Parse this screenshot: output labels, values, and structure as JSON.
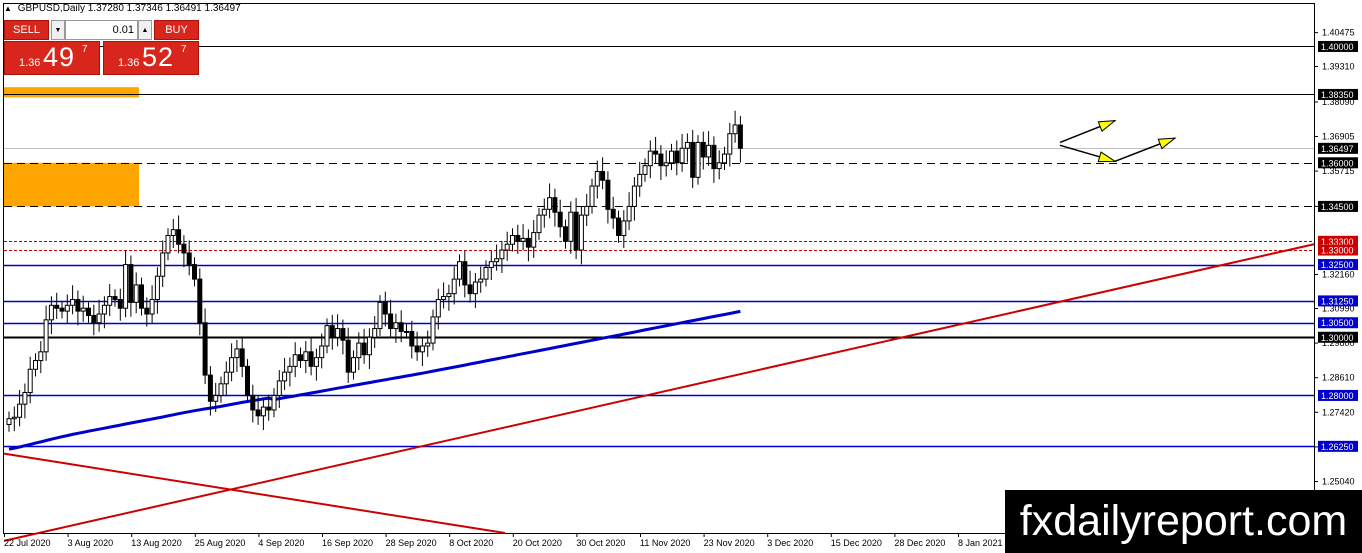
{
  "header": {
    "symbol_label": "GBPUSD,Daily",
    "ohlc": "1.37280 1.37346 1.36491 1.36497"
  },
  "trade_panel": {
    "sell_label": "SELL",
    "buy_label": "BUY",
    "lot_value": "0.01",
    "sell_price": {
      "prefix": "1.36",
      "big": "49",
      "sup": "7"
    },
    "buy_price": {
      "prefix": "1.36",
      "big": "52",
      "sup": "7"
    },
    "button_color": "#d9261c"
  },
  "watermark": "fxdailyreport.com",
  "chart_data": {
    "type": "candlestick",
    "symbol": "GBPUSD",
    "timeframe": "Daily",
    "ylim": [
      1.2327,
      1.4146
    ],
    "y_ticks": [
      "1.40475",
      "1.39310",
      "1.38090",
      "1.36905",
      "1.35715",
      "1.34500",
      "1.32160",
      "1.30990",
      "1.29800",
      "1.28610",
      "1.27420",
      "1.26230",
      "1.25040"
    ],
    "x_ticks": [
      "22 Jul 2020",
      "3 Aug 2020",
      "13 Aug 2020",
      "25 Aug 2020",
      "4 Sep 2020",
      "16 Sep 2020",
      "28 Sep 2020",
      "8 Oct 2020",
      "20 Oct 2020",
      "30 Oct 2020",
      "11 Nov 2020",
      "23 Nov 2020",
      "3 Dec 2020",
      "15 Dec 2020",
      "28 Dec 2020",
      "8 Jan 2021"
    ],
    "bullish_color": "#ffffff",
    "bearish_color": "#000000",
    "closes": [
      1.272,
      1.2725,
      1.277,
      1.281,
      1.289,
      1.292,
      1.295,
      1.306,
      1.311,
      1.31,
      1.309,
      1.311,
      1.313,
      1.309,
      1.31,
      1.3075,
      1.305,
      1.308,
      1.311,
      1.314,
      1.313,
      1.31,
      1.325,
      1.312,
      1.318,
      1.31,
      1.308,
      1.313,
      1.321,
      1.329,
      1.335,
      1.337,
      1.332,
      1.329,
      1.325,
      1.32,
      1.305,
      1.287,
      1.278,
      1.28,
      1.284,
      1.288,
      1.293,
      1.296,
      1.29,
      1.28,
      1.275,
      1.273,
      1.276,
      1.275,
      1.28,
      1.285,
      1.288,
      1.29,
      1.294,
      1.292,
      1.295,
      1.29,
      1.293,
      1.297,
      1.304,
      1.3,
      1.303,
      1.299,
      1.288,
      1.293,
      1.298,
      1.294,
      1.3,
      1.303,
      1.312,
      1.308,
      1.303,
      1.305,
      1.302,
      1.302,
      1.297,
      1.295,
      1.297,
      1.298,
      1.307,
      1.313,
      1.314,
      1.315,
      1.32,
      1.326,
      1.318,
      1.315,
      1.319,
      1.32,
      1.324,
      1.326,
      1.327,
      1.33,
      1.332,
      1.335,
      1.333,
      1.334,
      1.331,
      1.336,
      1.342,
      1.344,
      1.348,
      1.343,
      1.338,
      1.333,
      1.343,
      1.33,
      1.342,
      1.345,
      1.352,
      1.357,
      1.354,
      1.344,
      1.341,
      1.335,
      1.34,
      1.345,
      1.352,
      1.356,
      1.359,
      1.364,
      1.363,
      1.359,
      1.36,
      1.364,
      1.36,
      1.365,
      1.367,
      1.355,
      1.367,
      1.362,
      1.366,
      1.358,
      1.36,
      1.363,
      1.37,
      1.373,
      1.365
    ]
  },
  "levels": [
    {
      "label": "1.40000",
      "price": 1.4,
      "color": "#000000",
      "style": "solid",
      "label_bg": "#000000",
      "label_color": "#ffffff"
    },
    {
      "label": "1.38350",
      "price": 1.3835,
      "color": "#000000",
      "style": "solid",
      "label_bg": "#000000",
      "label_color": "#ffffff"
    },
    {
      "label": "1.36497",
      "price": 1.36497,
      "color": "#c0c0c0",
      "style": "solid",
      "label_bg": "#000000",
      "label_color": "#ffffff"
    },
    {
      "label": "1.36000",
      "price": 1.36,
      "color": "#000000",
      "style": "dashed",
      "label_bg": "#000000",
      "label_color": "#ffffff"
    },
    {
      "label": "1.34500",
      "price": 1.345,
      "color": "#000000",
      "style": "dashed",
      "label_bg": "#000000",
      "label_color": "#ffffff"
    },
    {
      "label": "1.33300",
      "price": 1.333,
      "color": "#cc0000",
      "style": "dotted",
      "label_bg": "#cc0000",
      "label_color": "#ffffff"
    },
    {
      "label": "1.33000",
      "price": 1.33,
      "color": "#cc0000",
      "style": "dotted",
      "label_bg": "#cc0000",
      "label_color": "#ffffff"
    },
    {
      "label": "1.32500",
      "price": 1.325,
      "color": "#0000cc",
      "style": "solid",
      "label_bg": "#0000cc",
      "label_color": "#ffffff"
    },
    {
      "label": "1.31250",
      "price": 1.3125,
      "color": "#0000cc",
      "style": "solid",
      "label_bg": "#0000cc",
      "label_color": "#ffffff"
    },
    {
      "label": "1.30500",
      "price": 1.305,
      "color": "#0000cc",
      "style": "solid",
      "label_bg": "#0000cc",
      "label_color": "#ffffff"
    },
    {
      "label": "1.30000",
      "price": 1.3,
      "color": "#000000",
      "style": "thick",
      "label_bg": "#000000",
      "label_color": "#ffffff"
    },
    {
      "label": "1.28000",
      "price": 1.28,
      "color": "#0000cc",
      "style": "solid",
      "label_bg": "#0000cc",
      "label_color": "#ffffff"
    },
    {
      "label": "1.26250",
      "price": 1.2625,
      "color": "#0000cc",
      "style": "solid",
      "label_bg": "#0000cc",
      "label_color": "#ffffff"
    }
  ],
  "zones": [
    {
      "from": 1.3825,
      "to": 1.386,
      "color": "#ffa500"
    },
    {
      "from": 1.345,
      "to": 1.36,
      "color": "#ffa500"
    }
  ],
  "trendline_color": "#cc0000",
  "moving_average_color": "#0000cc",
  "arrow_color": "#ffff00"
}
